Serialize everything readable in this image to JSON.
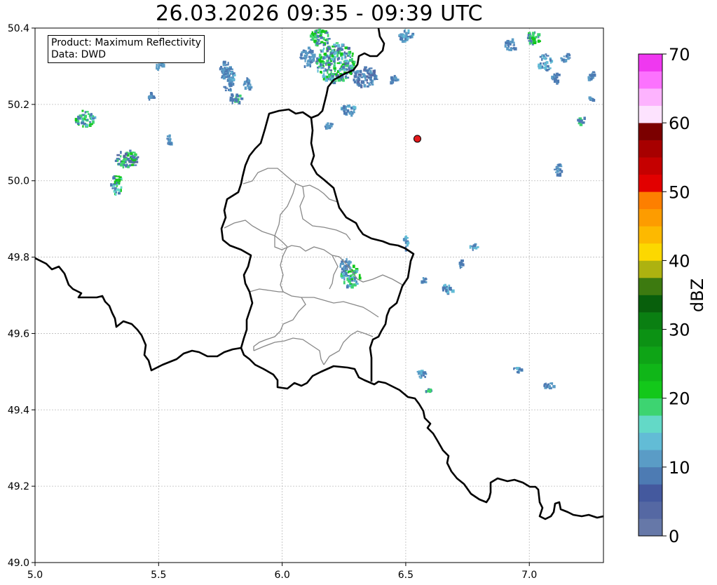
{
  "title": "26.03.2026 09:35 - 09:39 UTC",
  "info_box": {
    "product_line": "Product: Maximum Reflectivity",
    "data_line": "Data: DWD"
  },
  "map": {
    "lon_range": [
      5.0,
      7.3
    ],
    "lat_range": [
      49.0,
      50.4
    ],
    "x_ticks": [
      "5.0",
      "5.5",
      "6.0",
      "6.5",
      "7.0"
    ],
    "y_ticks": [
      "49.0",
      "49.2",
      "49.4",
      "49.6",
      "49.8",
      "50.0",
      "50.2",
      "50.4"
    ],
    "grid": true,
    "radar_site_marker": {
      "lon": 6.547,
      "lat": 50.11,
      "color": "#e31a1c"
    }
  },
  "colorbar": {
    "label": "dBZ",
    "range": [
      0,
      70
    ],
    "tick_labels": [
      "0",
      "10",
      "20",
      "30",
      "40",
      "50",
      "60",
      "70"
    ],
    "colors": [
      "#6678a8",
      "#5568a3",
      "#44599e",
      "#4d7bb3",
      "#5a9cc6",
      "#62bcd6",
      "#63d9c7",
      "#3dd471",
      "#13c81a",
      "#10b618",
      "#0ea416",
      "#0c9214",
      "#0a7f12",
      "#085f0c",
      "#3d7a10",
      "#adb210",
      "#fcd800",
      "#fdb900",
      "#fd9c00",
      "#fd7f00",
      "#e20000",
      "#c50000",
      "#a70000",
      "#7b0000",
      "#fde3fe",
      "#fdb3fe",
      "#fc72fe",
      "#ef38f0"
    ]
  }
}
